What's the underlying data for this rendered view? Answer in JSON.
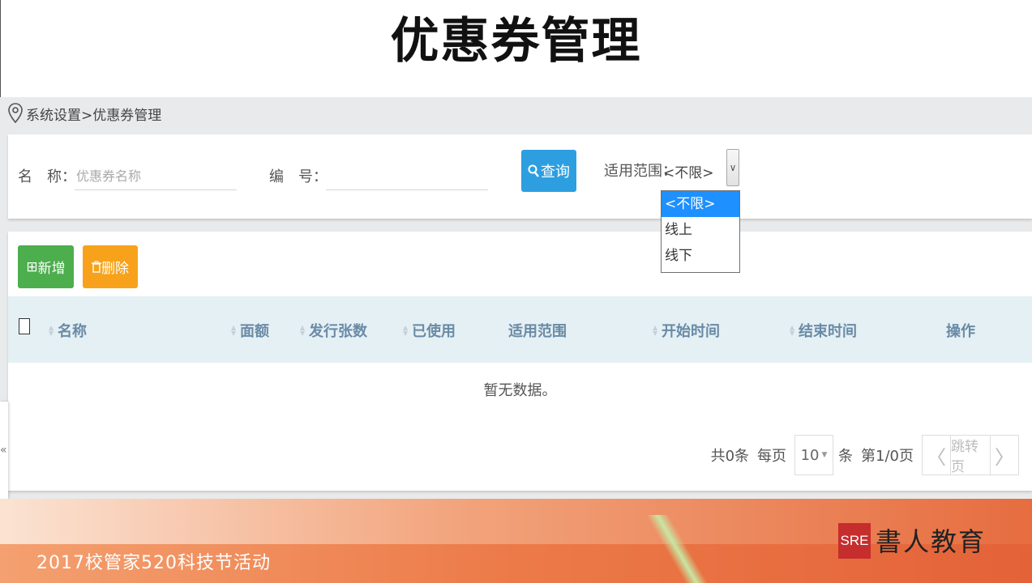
{
  "slide": {
    "title": "优惠券管理"
  },
  "breadcrumb": "系统设置>优惠券管理",
  "search": {
    "name_label": "名　称：",
    "name_placeholder": "优惠券名称",
    "code_label": "编　号：",
    "code_value": "",
    "query_button": "查询",
    "scope_label": "适用范围：",
    "scope_selected": "<不限>",
    "scope_options": [
      "<不限>",
      "线上",
      "线下"
    ]
  },
  "toolbar": {
    "add_label": "新增",
    "delete_label": "删除"
  },
  "table": {
    "columns": [
      "名称",
      "面额",
      "发行张数",
      "已使用",
      "适用范围",
      "开始时间",
      "结束时间",
      "操作"
    ],
    "empty_text": "暂无数据。"
  },
  "pagination": {
    "total_text": "共0条",
    "per_page_label": "每页",
    "page_size": "10",
    "unit": "条",
    "page_info": "第1/0页",
    "jump_label": "跳转页"
  },
  "footer": {
    "event_text": "2017校管家520科技节活动",
    "logo_mark": "SRE",
    "logo_text": "書人教育"
  },
  "icons": [
    "location-pin-icon",
    "search-icon",
    "plus-square-icon",
    "trash-icon",
    "sort-icon",
    "chevron-left-icon",
    "chevron-right-icon",
    "double-chevron-left-icon"
  ],
  "colors": {
    "query_button": "#2d9fe0",
    "add_button": "#4cae4c",
    "delete_button": "#f7a21a",
    "dropdown_selected": "#1e90ff",
    "table_header": "#e4f0f4"
  }
}
